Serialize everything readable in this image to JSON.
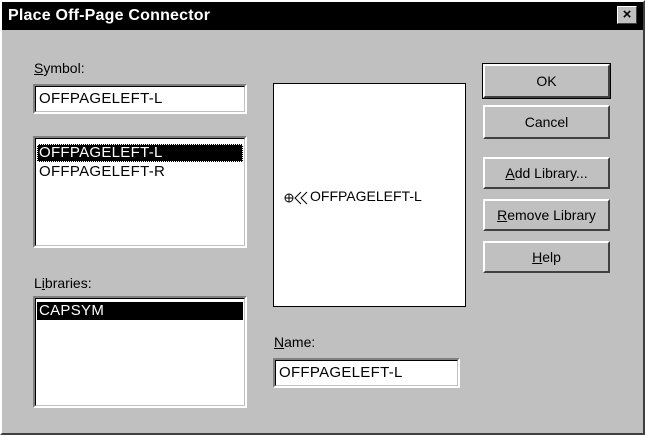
{
  "window": {
    "title": "Place Off-Page Connector",
    "close_glyph": "✕"
  },
  "symbol": {
    "label_accel": "S",
    "label_rest": "ymbol:",
    "value": "OFFPAGELEFT-L",
    "list": [
      "OFFPAGELEFT-L",
      "OFFPAGELEFT-R"
    ],
    "selected_index": 0
  },
  "libraries": {
    "label_pre": "L",
    "label_accel": "i",
    "label_rest": "braries:",
    "list": [
      "CAPSYM"
    ],
    "selected_index": 0
  },
  "preview": {
    "symbol_name": "OFFPAGELEFT-L",
    "icon": "offpage-connector-left-icon"
  },
  "name": {
    "label_accel": "N",
    "label_rest": "ame:",
    "value": "OFFPAGELEFT-L"
  },
  "buttons": {
    "ok": "OK",
    "cancel": "Cancel",
    "add_library_accel": "A",
    "add_library_rest": "dd Library...",
    "remove_library_accel": "R",
    "remove_library_rest": "emove Library",
    "help_accel": "H",
    "help_rest": "elp"
  }
}
